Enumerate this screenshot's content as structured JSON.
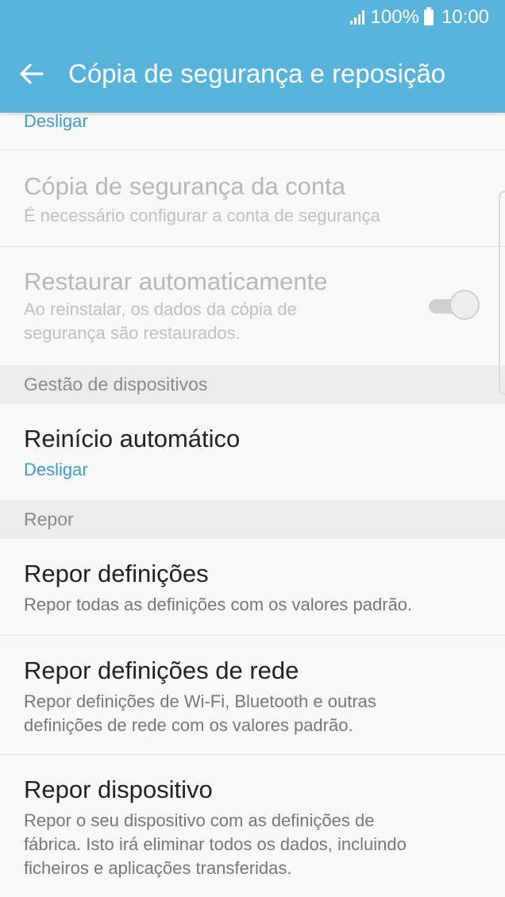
{
  "status_bar": {
    "battery_text": "100%",
    "time": "10:00",
    "icons": [
      "signal-icon",
      "battery-icon"
    ]
  },
  "app_bar": {
    "title": "Cópia de segurança e reposição",
    "back_icon": "arrow-left-icon"
  },
  "items": {
    "backup_toggle_sub": "Desligar",
    "account_backup": {
      "title": "Cópia de segurança da conta",
      "subtitle": "É necessário configurar a conta de segurança"
    },
    "auto_restore": {
      "title": "Restaurar automaticamente",
      "subtitle_line1": "Ao reinstalar, os dados da cópia de",
      "subtitle_line2": "segurança são restaurados.",
      "toggle_on": true
    }
  },
  "sections": {
    "device_management": "Gestão de dispositivos",
    "reset": "Repor"
  },
  "device_management": {
    "auto_restart": {
      "title": "Reinício automático",
      "subtitle": "Desligar"
    }
  },
  "reset": {
    "reset_settings": {
      "title": "Repor definições",
      "subtitle": "Repor todas as definições com os valores padrão."
    },
    "reset_network": {
      "title": "Repor definições de rede",
      "subtitle_line1": "Repor definições de Wi-Fi, Bluetooth e outras",
      "subtitle_line2": "definições de rede com os valores padrão."
    },
    "reset_device": {
      "title": "Repor dispositivo",
      "subtitle_line1": "Repor o seu dispositivo com as definições de",
      "subtitle_line2": "fábrica. Isto irá eliminar todos os dados, incluindo",
      "subtitle_line3": "ficheiros e aplicações transferidas."
    }
  },
  "colors": {
    "header": "#57b3d9",
    "accent_text": "#3d9dc6",
    "background": "#f8f8f8",
    "section_bg": "#ececec"
  }
}
